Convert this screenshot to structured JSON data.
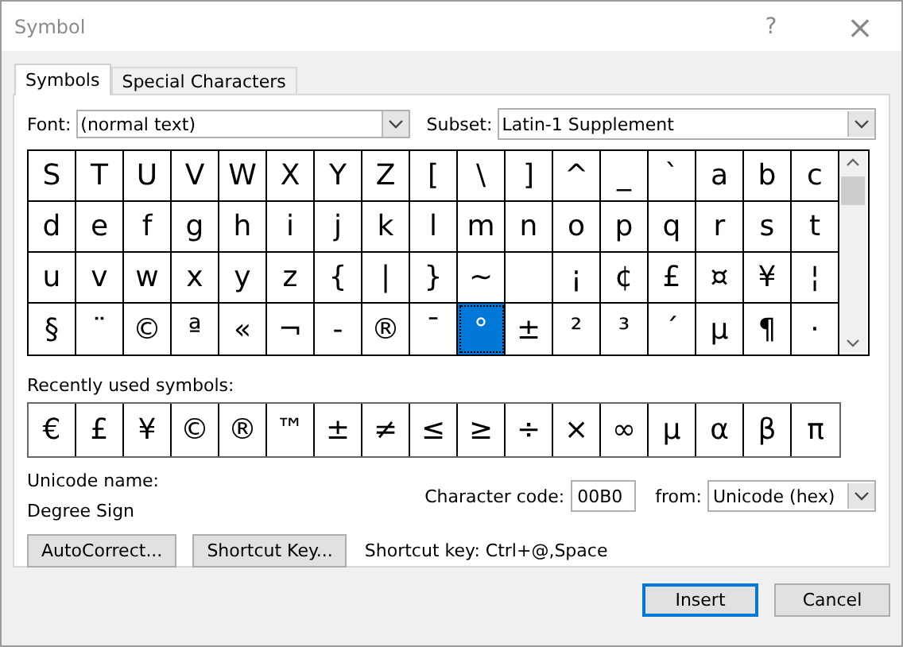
{
  "window": {
    "title": "Symbol",
    "help": "?",
    "close": "×"
  },
  "tabs": [
    {
      "label": "Symbols",
      "selected": true
    },
    {
      "label": "Special Characters",
      "selected": false
    }
  ],
  "font": {
    "label": "Font:",
    "value": "(normal text)"
  },
  "subset": {
    "label": "Subset:",
    "value": "Latin-1 Supplement"
  },
  "grid": [
    [
      {
        "char": "S",
        "selected": false
      },
      {
        "char": "T",
        "selected": false
      },
      {
        "char": "U",
        "selected": false
      },
      {
        "char": "V",
        "selected": false
      },
      {
        "char": "W",
        "selected": false
      },
      {
        "char": "X",
        "selected": false
      },
      {
        "char": "Y",
        "selected": false
      },
      {
        "char": "Z",
        "selected": false
      },
      {
        "char": "[",
        "selected": false
      },
      {
        "char": "\\",
        "selected": false
      },
      {
        "char": "]",
        "selected": false
      },
      {
        "char": "^",
        "selected": false
      },
      {
        "char": "_",
        "selected": false
      },
      {
        "char": "`",
        "selected": false
      },
      {
        "char": "a",
        "selected": false
      },
      {
        "char": "b",
        "selected": false
      },
      {
        "char": "c",
        "selected": false
      }
    ],
    [
      {
        "char": "d",
        "selected": false
      },
      {
        "char": "e",
        "selected": false
      },
      {
        "char": "f",
        "selected": false
      },
      {
        "char": "g",
        "selected": false
      },
      {
        "char": "h",
        "selected": false
      },
      {
        "char": "i",
        "selected": false
      },
      {
        "char": "j",
        "selected": false
      },
      {
        "char": "k",
        "selected": false
      },
      {
        "char": "l",
        "selected": false
      },
      {
        "char": "m",
        "selected": false
      },
      {
        "char": "n",
        "selected": false
      },
      {
        "char": "o",
        "selected": false
      },
      {
        "char": "p",
        "selected": false
      },
      {
        "char": "q",
        "selected": false
      },
      {
        "char": "r",
        "selected": false
      },
      {
        "char": "s",
        "selected": false
      },
      {
        "char": "t",
        "selected": false
      }
    ],
    [
      {
        "char": "u",
        "selected": false
      },
      {
        "char": "v",
        "selected": false
      },
      {
        "char": "w",
        "selected": false
      },
      {
        "char": "x",
        "selected": false
      },
      {
        "char": "y",
        "selected": false
      },
      {
        "char": "z",
        "selected": false
      },
      {
        "char": "{",
        "selected": false
      },
      {
        "char": "|",
        "selected": false
      },
      {
        "char": "}",
        "selected": false
      },
      {
        "char": "~",
        "selected": false
      },
      {
        "selected": false
      },
      {
        "char": "¡",
        "selected": false
      },
      {
        "char": "¢",
        "selected": false
      },
      {
        "char": "£",
        "selected": false
      },
      {
        "char": "¤",
        "selected": false
      },
      {
        "char": "¥",
        "selected": false
      },
      {
        "char": "¦",
        "selected": false
      }
    ],
    [
      {
        "char": "§",
        "selected": false
      },
      {
        "char": "¨",
        "selected": false
      },
      {
        "char": "©",
        "selected": false
      },
      {
        "char": "ª",
        "selected": false
      },
      {
        "char": "«",
        "selected": false
      },
      {
        "char": "¬",
        "selected": false
      },
      {
        "char": "-",
        "selected": false
      },
      {
        "char": "®",
        "selected": false
      },
      {
        "char": "¯",
        "selected": false
      },
      {
        "char": "°",
        "selected": true
      },
      {
        "char": "±",
        "selected": false
      },
      {
        "char": "²",
        "selected": false
      },
      {
        "char": "³",
        "selected": false
      },
      {
        "char": "´",
        "selected": false
      },
      {
        "char": "µ",
        "selected": false
      },
      {
        "char": "¶",
        "selected": false
      },
      {
        "char": "·",
        "selected": false
      }
    ]
  ],
  "recent": {
    "label": "Recently used symbols:",
    "symbols": [
      "€",
      "£",
      "¥",
      "©",
      "®",
      "™",
      "±",
      "≠",
      "≤",
      "≥",
      "÷",
      "×",
      "∞",
      "µ",
      "α",
      "β",
      "π"
    ]
  },
  "unicode_name": {
    "label": "Unicode name:",
    "value": "Degree Sign"
  },
  "character_code": {
    "label": "Character code:",
    "value": "00B0"
  },
  "from": {
    "label": "from:",
    "value": "Unicode (hex)"
  },
  "buttons": [
    {
      "label": "AutoCorrect..."
    },
    {
      "label": "Shortcut Key..."
    }
  ],
  "shortcut_text": "Shortcut key: Ctrl+@,Space",
  "footer_buttons": [
    {
      "label": "Insert",
      "default": true
    },
    {
      "label": "Cancel",
      "default": false
    }
  ]
}
